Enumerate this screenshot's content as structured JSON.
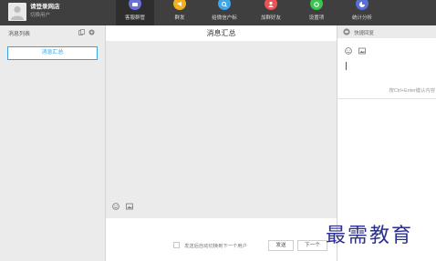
{
  "topbar": {
    "user_name": "请登录网店",
    "switch_user": "切换用户",
    "nav": [
      {
        "label": "客服群管",
        "icon": "chat-icon",
        "color": "#6b6fd8"
      },
      {
        "label": "群发",
        "icon": "megaphone-icon",
        "color": "#f2b01e"
      },
      {
        "label": "给微信户标",
        "icon": "search-icon",
        "color": "#41a5e8"
      },
      {
        "label": "加群好友",
        "icon": "add-user-icon",
        "color": "#ea5455"
      },
      {
        "label": "设置项",
        "icon": "gear-icon",
        "color": "#3cc452"
      },
      {
        "label": "统计分析",
        "icon": "chart-icon",
        "color": "#5b6fd6"
      }
    ]
  },
  "left": {
    "title": "消息列表",
    "summary_button": "消息汇总",
    "icons": [
      "copy-icon",
      "settings-icon"
    ]
  },
  "middle": {
    "title": "消息汇总",
    "auto_switch_label": "发送后自动切换到下一个用户",
    "send_label": "发送",
    "next_label": "下一个",
    "tools": [
      "emoji-icon",
      "image-icon"
    ]
  },
  "right": {
    "title": "快捷回复",
    "hint": "按Ctrl+Enter键认内容",
    "tools": [
      "emoji-icon",
      "image-icon"
    ]
  },
  "watermark": "最需教育",
  "colors": {
    "topbar": "#3f3f3f",
    "accent": "#39a3e0",
    "panel": "#ebebeb",
    "watermark": "#2b2f8f"
  }
}
